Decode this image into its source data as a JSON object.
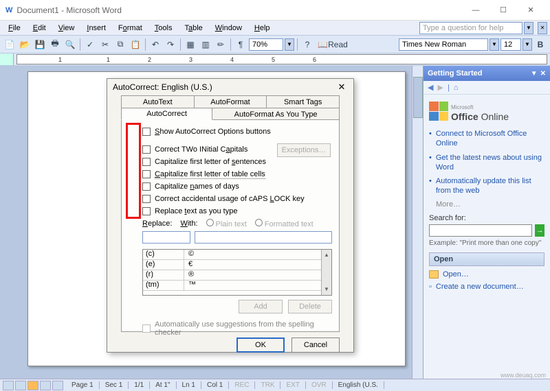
{
  "window": {
    "title": "Document1 - Microsoft Word"
  },
  "menu": [
    "File",
    "Edit",
    "View",
    "Insert",
    "Format",
    "Tools",
    "Table",
    "Window",
    "Help"
  ],
  "helpBox": "Type a question for help",
  "toolbar": {
    "zoom": "70%",
    "read": "Read",
    "font": "Times New Roman",
    "size": "12"
  },
  "ruler": {
    "marks": [
      "1",
      "",
      "1",
      "2",
      "3",
      "4",
      "5",
      "6"
    ]
  },
  "taskpane": {
    "title": "Getting Started",
    "office": {
      "brand": "Office",
      "suffix": "Online",
      "prefix": "Microsoft"
    },
    "links": [
      "Connect to Microsoft Office Online",
      "Get the latest news about using Word",
      "Automatically update this list from the web"
    ],
    "more": "More…",
    "searchLabel": "Search for:",
    "example": "Example: \"Print more than one copy\"",
    "openHeader": "Open",
    "openLink": "Open…",
    "newDoc": "Create a new document…"
  },
  "dialog": {
    "title": "AutoCorrect: English (U.S.)",
    "tabsTop": [
      "AutoText",
      "AutoFormat",
      "Smart Tags"
    ],
    "tabsBottom": [
      "AutoCorrect",
      "AutoFormat As You Type"
    ],
    "showBtn": "Show AutoCorrect Options buttons",
    "chk": [
      "Correct TWo INitial CApitals",
      "Capitalize first letter of sentences",
      "Capitalize first letter of table cells",
      "Capitalize names of days",
      "Correct accidental usage of cAPS LOCK key",
      "Replace text as you type"
    ],
    "exceptions": "Exceptions…",
    "replaceLbl": "Replace:",
    "withLbl": "With:",
    "plain": "Plain text",
    "formatted": "Formatted text",
    "rows": [
      {
        "k": "(c)",
        "v": "©"
      },
      {
        "k": "(e)",
        "v": "€"
      },
      {
        "k": "(r)",
        "v": "®"
      },
      {
        "k": "(tm)",
        "v": "™"
      }
    ],
    "add": "Add",
    "delete": "Delete",
    "autoSug": "Automatically use suggestions from the spelling checker",
    "ok": "OK",
    "cancel": "Cancel"
  },
  "status": {
    "page": "Page 1",
    "sec": "Sec 1",
    "frac": "1/1",
    "at": "At 1\"",
    "ln": "Ln 1",
    "col": "Col 1",
    "ind": [
      "REC",
      "TRK",
      "EXT",
      "OVR"
    ],
    "lang": "English (U.S."
  },
  "watermark": "www.deuaq.com"
}
